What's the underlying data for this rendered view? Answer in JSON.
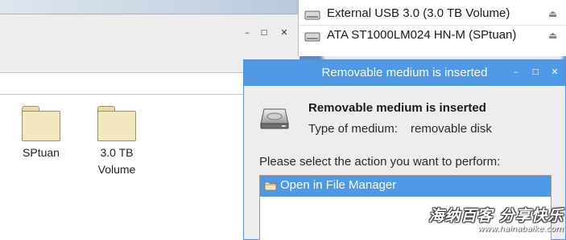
{
  "file_manager": {
    "window_controls": {
      "minimize": "–",
      "maximize": "□",
      "close": "✕"
    },
    "folders": [
      {
        "label": "SPtuan"
      },
      {
        "label": "3.0 TB Volume"
      }
    ]
  },
  "drives_menu": {
    "items": [
      {
        "label": "External USB 3.0 (3.0 TB Volume)",
        "icon": "drive-icon",
        "eject": "⏏"
      },
      {
        "label": "ATA ST1000LM024 HN-M (SPtuan)",
        "icon": "drive-icon",
        "eject": "⏏"
      }
    ]
  },
  "dialog": {
    "title": "Removable medium is inserted",
    "window_controls": {
      "minimize": "–",
      "maximize": "□",
      "close": "✕"
    },
    "heading": "Removable medium is inserted",
    "medium_label": "Type of medium:",
    "medium_value": "removable disk",
    "prompt": "Please select the action you want to perform:",
    "actions": [
      {
        "label": "Open in File Manager",
        "icon": "folder-icon",
        "selected": true
      }
    ]
  },
  "watermark": {
    "main": "海纳百客 分享快乐",
    "sub": "www.hainabaike.com"
  },
  "colors": {
    "accent": "#4e98e6",
    "folder": "#f3e7c0"
  }
}
